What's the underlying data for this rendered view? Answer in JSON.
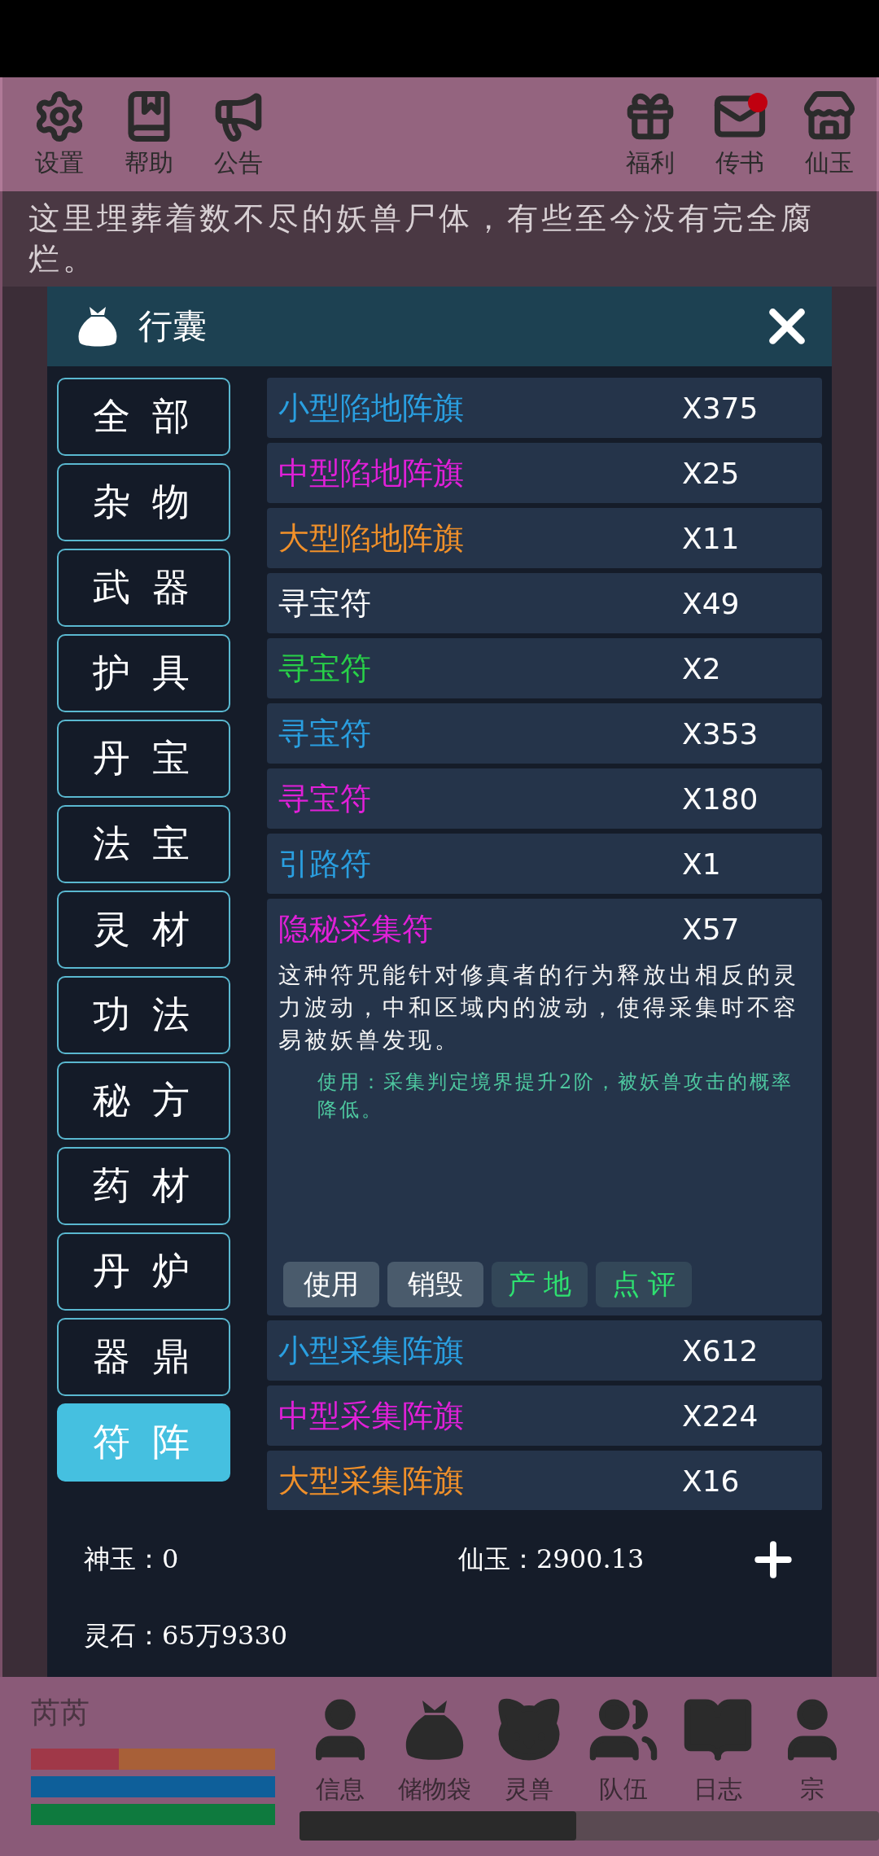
{
  "top_bar": {
    "left": [
      {
        "label": "设置"
      },
      {
        "label": "帮助"
      },
      {
        "label": "公告"
      }
    ],
    "right": [
      {
        "label": "福利",
        "badge": false
      },
      {
        "label": "传书",
        "badge": true
      },
      {
        "label": "仙玉",
        "badge": false
      }
    ]
  },
  "scene_text": "这里埋葬着数不尽的妖兽尸体，有些至今没有完全腐烂。",
  "bag": {
    "title": "行囊",
    "categories": [
      {
        "label": "全 部",
        "selected": false
      },
      {
        "label": "杂 物",
        "selected": false
      },
      {
        "label": "武 器",
        "selected": false
      },
      {
        "label": "护 具",
        "selected": false
      },
      {
        "label": "丹 宝",
        "selected": false
      },
      {
        "label": "法 宝",
        "selected": false
      },
      {
        "label": "灵 材",
        "selected": false
      },
      {
        "label": "功 法",
        "selected": false
      },
      {
        "label": "秘 方",
        "selected": false
      },
      {
        "label": "药 材",
        "selected": false
      },
      {
        "label": "丹 炉",
        "selected": false
      },
      {
        "label": "器 鼎",
        "selected": false
      },
      {
        "label": "符 阵",
        "selected": true
      }
    ],
    "items": [
      {
        "name": "小型陷地阵旗",
        "color": "#2a9fe0",
        "count": "X375"
      },
      {
        "name": "中型陷地阵旗",
        "color": "#e020d8",
        "count": "X25"
      },
      {
        "name": "大型陷地阵旗",
        "color": "#f0902a",
        "count": "X11"
      },
      {
        "name": "寻宝符",
        "color": "#ffffff",
        "count": "X49"
      },
      {
        "name": "寻宝符",
        "color": "#28d048",
        "count": "X2"
      },
      {
        "name": "寻宝符",
        "color": "#2a9fe0",
        "count": "X353"
      },
      {
        "name": "寻宝符",
        "color": "#e020d8",
        "count": "X180"
      },
      {
        "name": "引路符",
        "color": "#2a9fe0",
        "count": "X1"
      },
      {
        "name": "隐秘采集符",
        "color": "#e020d8",
        "count": "X57",
        "description": "这种符咒能针对修真者的行为释放出相反的灵力波动，中和区域内的波动，使得采集时不容易被妖兽发现。",
        "usage": "使用：采集判定境界提升2阶，被妖兽攻击的概率降低。",
        "actions": [
          {
            "label": "使用",
            "kind": "plain"
          },
          {
            "label": "销毁",
            "kind": "plain"
          },
          {
            "label": "产 地",
            "kind": "info"
          },
          {
            "label": "点 评",
            "kind": "info"
          }
        ]
      },
      {
        "name": "小型采集阵旗",
        "color": "#2a9fe0",
        "count": "X612"
      },
      {
        "name": "中型采集阵旗",
        "color": "#e020d8",
        "count": "X224"
      },
      {
        "name": "大型采集阵旗",
        "color": "#f0902a",
        "count": "X16"
      }
    ],
    "footer": {
      "shen_yu": "神玉：0",
      "xian_yu": "仙玉：2900.13",
      "ling_shi": "灵石：65万9330"
    }
  },
  "player": {
    "name": "芮芮",
    "bars": [
      {
        "color": "#a03848",
        "level": 0.36
      },
      {
        "color": "#0e5f9a",
        "level": 1
      },
      {
        "color": "#0e7a3e",
        "level": 1
      }
    ]
  },
  "nav": [
    {
      "label": "信息"
    },
    {
      "label": "储物袋"
    },
    {
      "label": "灵兽"
    },
    {
      "label": "队伍"
    },
    {
      "label": "日志"
    },
    {
      "label": "宗"
    }
  ]
}
